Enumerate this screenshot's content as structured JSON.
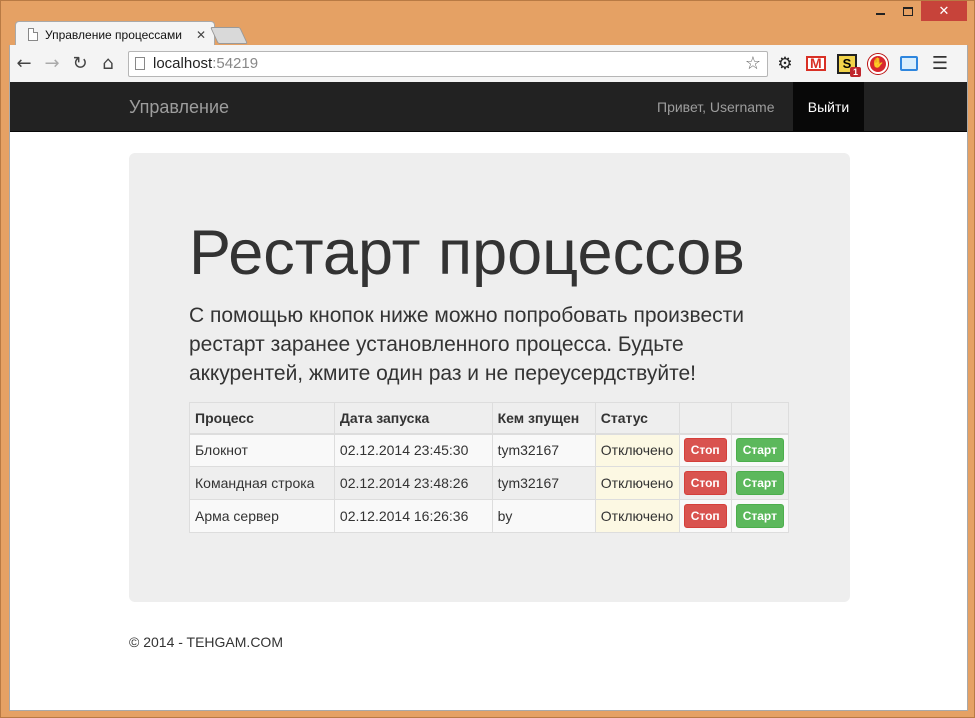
{
  "browser": {
    "tab_title": "Управление процессами",
    "url_host": "localhost",
    "url_port": ":54219",
    "accent_color": "#e5a164"
  },
  "navbar": {
    "brand": "Управление",
    "greeting": "Привет, Username",
    "logout_label": "Выйти"
  },
  "jumbotron": {
    "heading": "Рестарт процессов",
    "lead": "С помощью кнопок ниже можно попробовать произвести рестарт заранее установленного процесса. Будьте аккурентей, жмите один раз и не переусердствуйте!"
  },
  "table": {
    "headers": [
      "Процесс",
      "Дата запуска",
      "Кем зпущен",
      "Статус",
      "",
      ""
    ],
    "rows": [
      {
        "process": "Блокнот",
        "started": "02.12.2014 23:45:30",
        "by": "tym32167",
        "status": "Отключено",
        "stop": "Стоп",
        "start": "Старт"
      },
      {
        "process": "Командная строка",
        "started": "02.12.2014 23:48:26",
        "by": "tym32167",
        "status": "Отключено",
        "stop": "Стоп",
        "start": "Старт"
      },
      {
        "process": "Арма сервер",
        "started": "02.12.2014 16:26:36",
        "by": "by",
        "status": "Отключено",
        "stop": "Стоп",
        "start": "Старт"
      }
    ]
  },
  "footer": {
    "text": "© 2014 - TEHGAM.COM"
  },
  "extensions": {
    "s_badge": "1"
  }
}
